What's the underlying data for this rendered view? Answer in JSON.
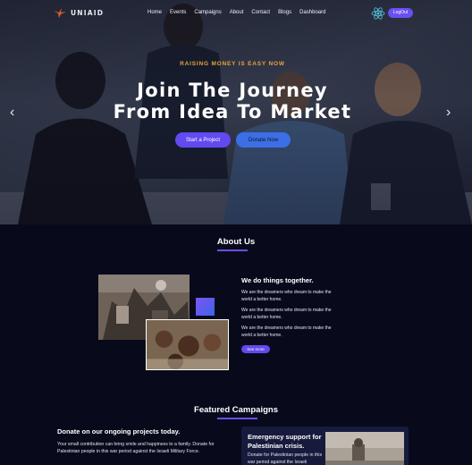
{
  "brand": {
    "name": "UNIAID",
    "icon": "eagle-logo"
  },
  "nav": {
    "links": [
      "Home",
      "Events",
      "Campaigns",
      "About",
      "Contact",
      "Blogs",
      "Dashboard"
    ],
    "logout_label": "LogOut",
    "react_icon": "react-icon"
  },
  "hero": {
    "eyebrow": "RAISING MONEY IS EASY NOW",
    "title_line1": "Join The Journey",
    "title_line2": "From Idea To Market",
    "start_label": "Start a Project",
    "donate_label": "Donate Now",
    "prev_arrow": "‹",
    "next_arrow": "›"
  },
  "about": {
    "title": "About Us",
    "heading": "We do things together.",
    "paragraphs": [
      "We are the dreamers who dream to make the world a better home.",
      "We are the dreamers who dream to make the world a better home.",
      "We are the dreamers who dream to make the world a better home."
    ],
    "see_more_label": "See more"
  },
  "campaigns": {
    "title": "Featured Campaigns",
    "left_title": "Donate on our ongoing projects today.",
    "left_text": "Your small contribution can bring smile and happiness to a family. Donate for Palestinian people in this war period against the Israeli Military Force.",
    "card_title": "Emergency support for Palestinian crisis.",
    "card_text": "Donate for Palestinian people in this war period against the Israeli"
  },
  "colors": {
    "accent": "#6249f0",
    "secondary": "#3c6fe6",
    "eyebrow": "#e6a33b",
    "background": "#080a1c"
  }
}
